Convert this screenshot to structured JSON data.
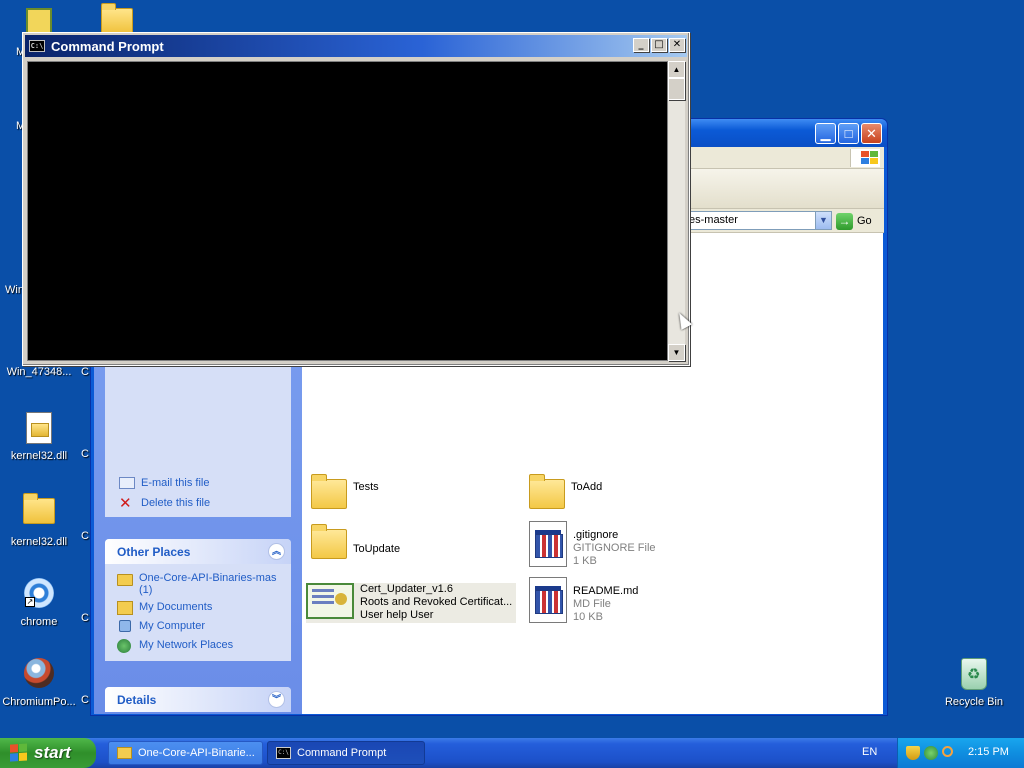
{
  "desktop": {
    "icons": [
      {
        "label": "M"
      },
      {
        "label": ""
      },
      {
        "label": "M"
      },
      {
        "label": "Win"
      },
      {
        "label": "Win_47348..."
      },
      {
        "label": "kernel32.dll"
      },
      {
        "label": "kernel32.dll"
      },
      {
        "label": "chrome"
      },
      {
        "label": "ChromiumPo..."
      },
      {
        "label": "Recycle Bin"
      }
    ],
    "peek_labels": [
      "C",
      "C",
      "C",
      "C",
      "C"
    ]
  },
  "cmd_window": {
    "title": "Command Prompt",
    "icon_text": "C:\\",
    "buttons": {
      "minimize": "_",
      "maximize": "□",
      "close": "✕"
    }
  },
  "explorer": {
    "address_value": "es-master",
    "go_label": "Go",
    "tasks_partial": [
      {
        "label": "E-mail this file",
        "icon": "mail-icon"
      },
      {
        "label": "Delete this file",
        "icon": "delete-icon"
      }
    ],
    "other_places": {
      "title": "Other Places",
      "items": [
        {
          "label": "One-Core-API-Binaries-mas (1)",
          "icon": "folder-icon"
        },
        {
          "label": "My Documents",
          "icon": "my-documents-icon"
        },
        {
          "label": "My Computer",
          "icon": "my-computer-icon"
        },
        {
          "label": "My Network Places",
          "icon": "network-places-icon"
        }
      ]
    },
    "details": {
      "title": "Details"
    },
    "files": [
      {
        "name": "Tests",
        "type": "folder"
      },
      {
        "name": "ToAdd",
        "type": "folder"
      },
      {
        "name": "ToUpdate",
        "type": "folder"
      },
      {
        "name": ".gitignore",
        "sub1": "GITIGNORE File",
        "sub2": "1 KB",
        "type": "doc"
      },
      {
        "name": "Cert_Updater_v1.6",
        "sub1": "Roots and Revoked Certificat...",
        "sub2": "User help User",
        "type": "cert"
      },
      {
        "name": "README.md",
        "sub1": "MD File",
        "sub2": "10 KB",
        "type": "doc"
      }
    ]
  },
  "taskbar": {
    "start_label": "start",
    "items": [
      {
        "label": "One-Core-API-Binarie..."
      },
      {
        "label": "Command Prompt"
      }
    ],
    "language": "EN",
    "clock": "2:15 PM"
  },
  "colors": {
    "desktop": "#0a4fa8",
    "xp_blue": "#0b5ad6",
    "link_blue": "#215dc6",
    "taskbar_blue": "#245edb",
    "start_green": "#2f8f2a"
  }
}
